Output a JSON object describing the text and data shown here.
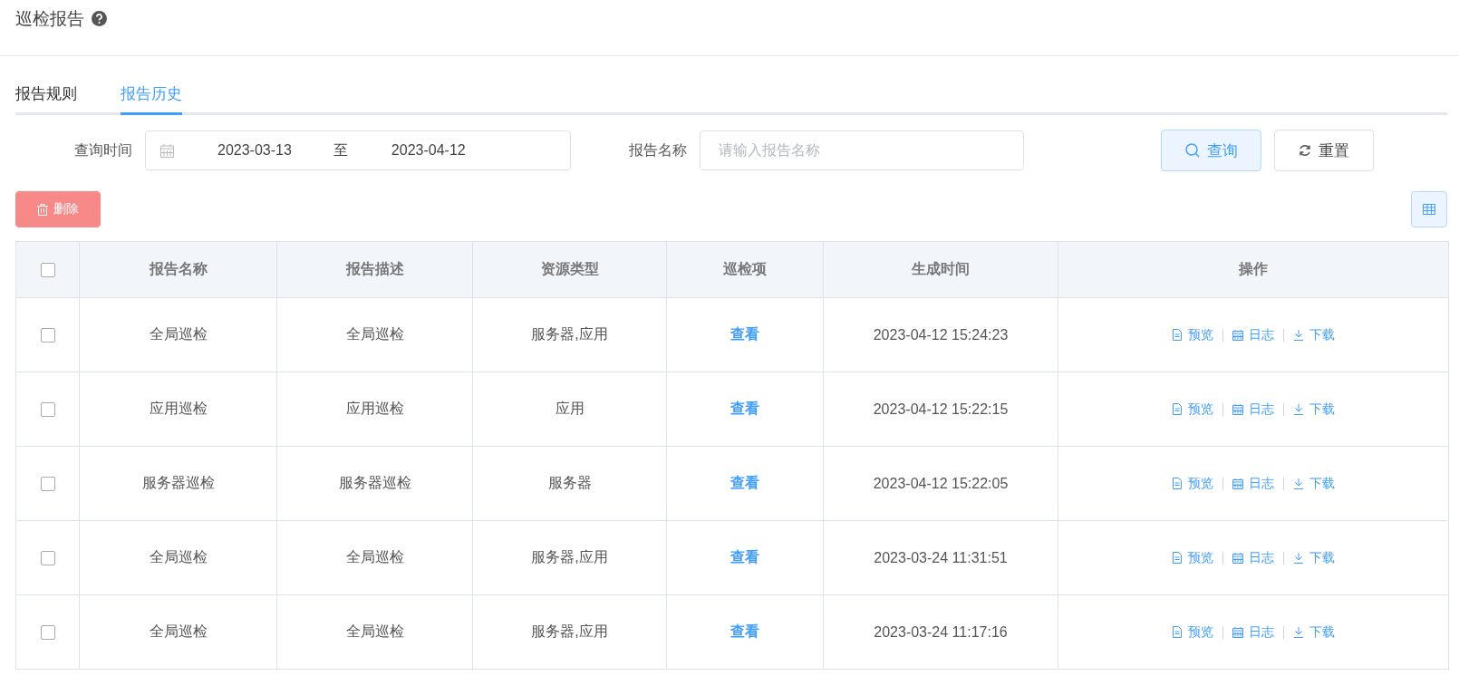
{
  "page": {
    "title": "巡检报告"
  },
  "tabs": [
    {
      "label": "报告规则",
      "selected": false
    },
    {
      "label": "报告历史",
      "selected": true
    }
  ],
  "filters": {
    "time_label": "查询时间",
    "start_date": "2023-03-13",
    "separator": "至",
    "end_date": "2023-04-12",
    "name_label": "报告名称",
    "name_placeholder": "请输入报告名称",
    "search_button": "查询",
    "reset_button": "重置"
  },
  "toolbar": {
    "delete_button": "删除"
  },
  "table": {
    "all_checked": false,
    "columns": [
      "报告名称",
      "报告描述",
      "资源类型",
      "巡检项",
      "生成时间",
      "操作"
    ],
    "rows": [
      {
        "checked": false,
        "name": "全局巡检",
        "description": "全局巡检",
        "resource_type": "服务器,应用",
        "items_link": "查看",
        "created": "2023-04-12 15:24:23",
        "actions": [
          "预览",
          "日志",
          "下载"
        ]
      },
      {
        "checked": false,
        "name": "应用巡检",
        "description": "应用巡检",
        "resource_type": "应用",
        "items_link": "查看",
        "created": "2023-04-12 15:22:15",
        "actions": [
          "预览",
          "日志",
          "下载"
        ]
      },
      {
        "checked": false,
        "name": "服务器巡检",
        "description": "服务器巡检",
        "resource_type": "服务器",
        "items_link": "查看",
        "created": "2023-04-12 15:22:05",
        "actions": [
          "预览",
          "日志",
          "下载"
        ]
      },
      {
        "checked": false,
        "name": "全局巡检",
        "description": "全局巡检",
        "resource_type": "服务器,应用",
        "items_link": "查看",
        "created": "2023-03-24 11:31:51",
        "actions": [
          "预览",
          "日志",
          "下载"
        ]
      },
      {
        "checked": false,
        "name": "全局巡检",
        "description": "全局巡检",
        "resource_type": "服务器,应用",
        "items_link": "查看",
        "created": "2023-03-24 11:17:16",
        "actions": [
          "预览",
          "日志",
          "下载"
        ]
      }
    ]
  }
}
